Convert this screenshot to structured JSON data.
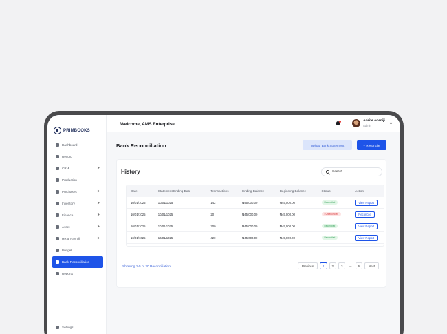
{
  "app": {
    "logo_text": "PRIMBOOKS"
  },
  "sidebar": {
    "items": [
      {
        "label": "Dashboard",
        "icon": "grid-icon",
        "chevron": false,
        "active": false
      },
      {
        "label": "Record",
        "icon": "record-icon",
        "chevron": false,
        "active": false
      },
      {
        "label": "CRM",
        "icon": "crm-icon",
        "chevron": true,
        "active": false
      },
      {
        "label": "Production",
        "icon": "production-icon",
        "chevron": false,
        "active": false
      },
      {
        "label": "Purchases",
        "icon": "cart-icon",
        "chevron": true,
        "active": false
      },
      {
        "label": "Inventory",
        "icon": "box-icon",
        "chevron": true,
        "active": false
      },
      {
        "label": "Finance",
        "icon": "finance-icon",
        "chevron": true,
        "active": false
      },
      {
        "label": "Asset",
        "icon": "asset-icon",
        "chevron": true,
        "active": false
      },
      {
        "label": "HR & Payroll",
        "icon": "people-icon",
        "chevron": true,
        "active": false
      },
      {
        "label": "Budget",
        "icon": "budget-icon",
        "chevron": false,
        "active": false
      },
      {
        "label": "Bank Reconciliation",
        "icon": "bank-icon",
        "chevron": false,
        "active": true
      },
      {
        "label": "Reports",
        "icon": "report-icon",
        "chevron": false,
        "active": false
      }
    ],
    "settings_label": "Settings"
  },
  "header": {
    "welcome": "Welcome, AMS Enterprise",
    "user_name": "Adeife Adeniji",
    "user_role": "Admin"
  },
  "page": {
    "title": "Bank Reconciliation",
    "upload_label": "Upload Bank Statement",
    "reconcile_label": "+ Reconcile"
  },
  "history": {
    "title": "History",
    "search_placeholder": "Search",
    "columns": [
      "Date",
      "Statement Ending Date",
      "Transactions",
      "Ending Balance",
      "Beginning Balance",
      "Status",
      "Action"
    ],
    "rows": [
      {
        "date": "10/01/1025",
        "ending_date": "10/01/1025",
        "transactions": "142",
        "ending_balance": "₦45,000.00",
        "beginning_balance": "₦45,000.00",
        "status": "Reconciled",
        "status_type": "ok",
        "action": "View Report"
      },
      {
        "date": "10/01/1025",
        "ending_date": "10/01/1025",
        "transactions": "20",
        "ending_balance": "₦45,000.00",
        "beginning_balance": "₦45,000.00",
        "status": "• Unreconciled",
        "status_type": "pend",
        "action": "Reconcile"
      },
      {
        "date": "10/01/1025",
        "ending_date": "10/01/1025",
        "transactions": "200",
        "ending_balance": "₦45,000.00",
        "beginning_balance": "₦45,000.00",
        "status": "Reconciled",
        "status_type": "ok",
        "action": "View Report"
      },
      {
        "date": "10/01/1025",
        "ending_date": "10/01/1025",
        "transactions": "420",
        "ending_balance": "₦45,000.00",
        "beginning_balance": "₦45,000.00",
        "status": "Reconciled",
        "status_type": "ok",
        "action": "View Report"
      }
    ],
    "showing": "Showing 1-5 of 20 Reconciliation",
    "pagination": {
      "previous": "Previous",
      "pages": [
        "1",
        "2",
        "3"
      ],
      "ellipsis": "...",
      "last": "6",
      "next": "Next"
    }
  },
  "colors": {
    "accent": "#1e54e8",
    "success": "#2f9e55",
    "danger": "#d8383a"
  }
}
